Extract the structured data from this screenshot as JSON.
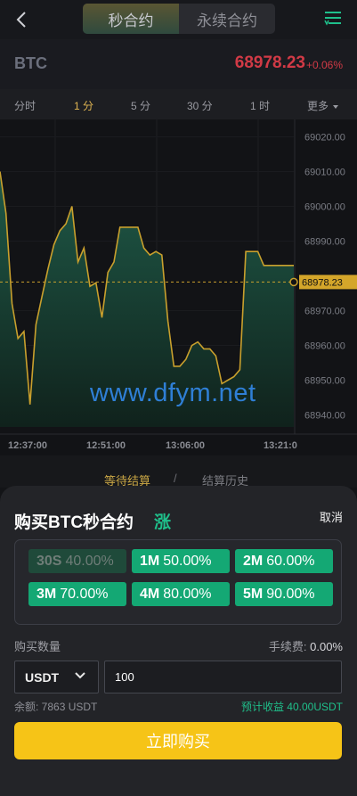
{
  "header": {
    "tabs": [
      {
        "label": "秒合约",
        "active": true
      },
      {
        "label": "永续合约",
        "active": false
      }
    ]
  },
  "ticker": {
    "symbol": "BTC",
    "price": "68978.23",
    "change": "+0.06%",
    "change_color": "#d23a46"
  },
  "intervals": [
    {
      "label": "分时",
      "active": false
    },
    {
      "label": "1 分",
      "active": true
    },
    {
      "label": "5 分",
      "active": false
    },
    {
      "label": "30 分",
      "active": false
    },
    {
      "label": "1 时",
      "active": false
    },
    {
      "label": "更多",
      "active": false
    }
  ],
  "chart_data": {
    "type": "area",
    "y_ticks": [
      "69020.00",
      "69010.00",
      "69000.00",
      "68990.00",
      "68970.00",
      "68960.00",
      "68950.00",
      "68940.00"
    ],
    "x_ticks": [
      "12:37:00",
      "12:51:00",
      "13:06:00",
      "13:21:0"
    ],
    "current_price_label": "68978.23",
    "ylim": [
      68935,
      69025
    ],
    "line_color": "#c9a02d",
    "values": [
      69010,
      68998,
      68972,
      68962,
      68964,
      68943,
      68966,
      68974,
      68982,
      68989,
      68993,
      68995,
      69000,
      68984,
      68988,
      68977,
      68978,
      68968,
      68981,
      68984,
      68994,
      68994,
      68994,
      68994,
      68988,
      68986,
      68987,
      68986,
      68967,
      68954,
      68954,
      68956,
      68960,
      68961,
      68959,
      68959,
      68957,
      68949,
      68950,
      68951,
      68953,
      68987,
      68987,
      68987,
      68983,
      68983,
      68983,
      68983,
      68983,
      68983
    ]
  },
  "watermark": "www.dfym.net",
  "subtabs": {
    "pending": "等待结算",
    "separator": "/",
    "history": "结算历史"
  },
  "sheet": {
    "title": "购买BTC秒合约",
    "direction": "涨",
    "direction_color": "#1fc08b",
    "cancel": "取消",
    "options": [
      {
        "time": "30S",
        "rate": "40.00%",
        "disabled": true
      },
      {
        "time": "1M",
        "rate": "50.00%",
        "disabled": false
      },
      {
        "time": "2M",
        "rate": "60.00%",
        "disabled": false
      },
      {
        "time": "3M",
        "rate": "70.00%",
        "disabled": false
      },
      {
        "time": "4M",
        "rate": "80.00%",
        "disabled": false
      },
      {
        "time": "5M",
        "rate": "90.00%",
        "disabled": false
      }
    ],
    "qty_label": "购买数量",
    "fee_label": "手续费: ",
    "fee_value": "0.00%",
    "currency": "USDT",
    "amount": "100",
    "balance": "余额: 7863 USDT",
    "profit": "预计收益 40.00USDT",
    "buy_label": "立即购买",
    "buy_color": "#f6c417"
  }
}
